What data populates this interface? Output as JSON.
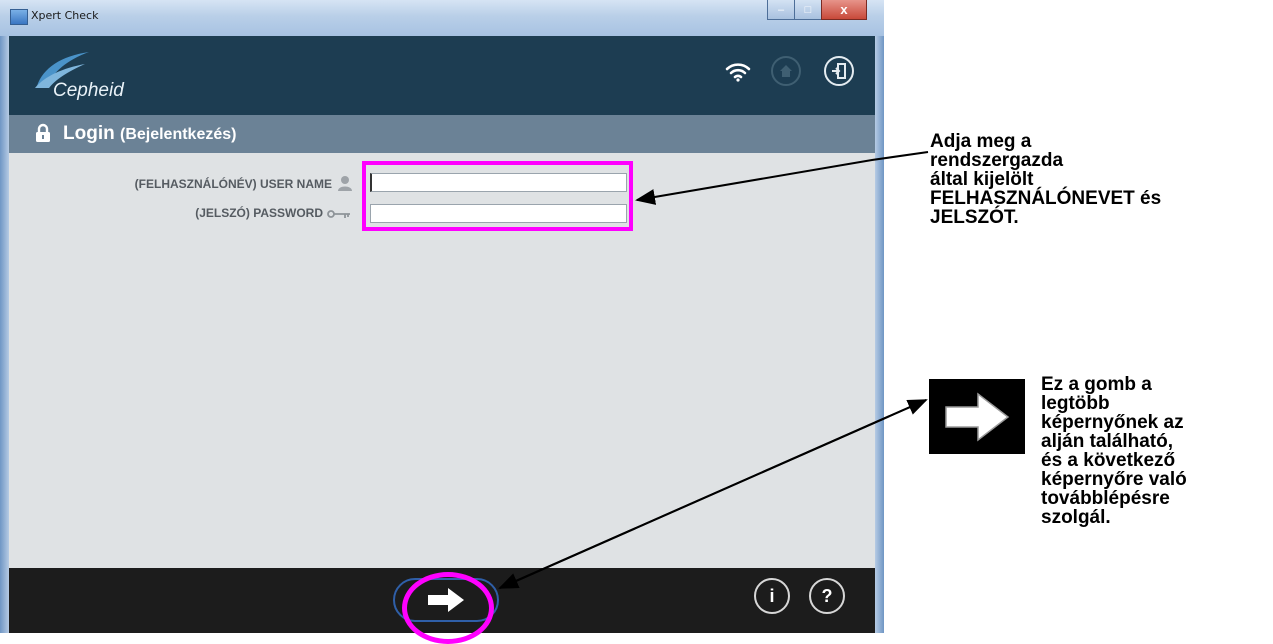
{
  "window": {
    "title": "Xpert Check",
    "controls": {
      "minimize": "–",
      "maximize": "□",
      "close": "x"
    }
  },
  "header": {
    "logo_text": "Cepheid",
    "icons": [
      "wifi-icon",
      "home-icon",
      "exit-icon"
    ]
  },
  "login_bar": {
    "title": "Login",
    "title_translation": "(Bejelentkezés)",
    "icon": "lock-icon"
  },
  "form": {
    "username_label": "(FELHASZNÁLÓNÉV) USER NAME",
    "username_value": "",
    "username_icon": "user-icon",
    "password_label": "(JELSZÓ) PASSWORD",
    "password_value": "",
    "password_icon": "key-icon"
  },
  "footer": {
    "next_icon": "arrow-right-icon",
    "info_label": "i",
    "help_label": "?"
  },
  "annotations": {
    "fields_note": [
      "Adja meg a",
      "rendszergazda",
      "által kijelölt",
      "FELHASZNÁLÓNEVET és",
      "JELSZÓT."
    ],
    "next_note": [
      "Ez a gomb a",
      "legtöbb",
      "képernyőnek az",
      "alján található,",
      "és a következő",
      "képernyőre való",
      "továbblépésre",
      "szolgál."
    ],
    "highlight_color": "#ff00ff"
  },
  "colors": {
    "header_bg": "#1d3d52",
    "login_bar_bg": "#6b8296",
    "content_bg": "#dfe2e4",
    "footer_bg": "#1c1c1c"
  }
}
